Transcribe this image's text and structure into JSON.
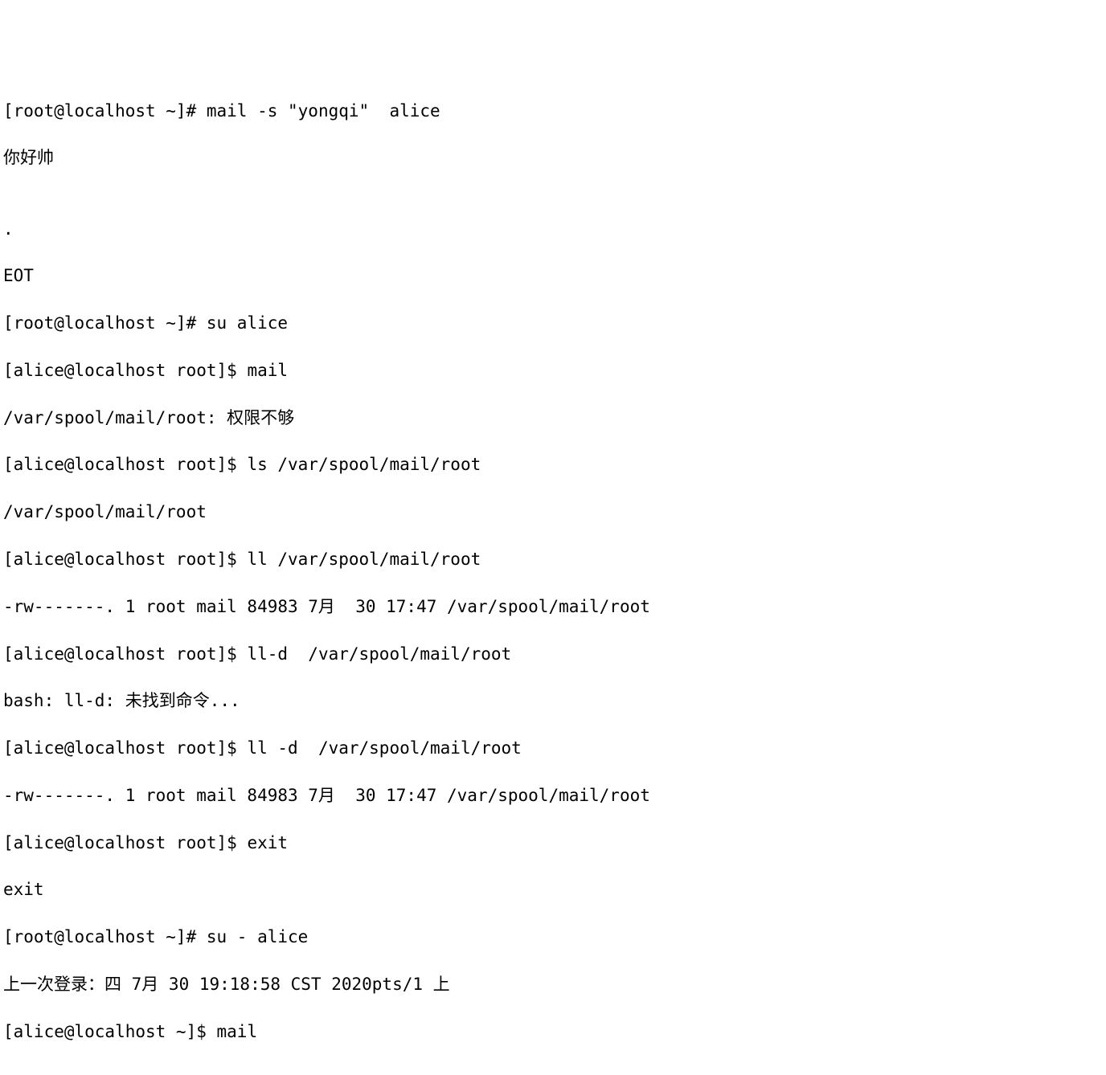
{
  "lines": [
    {
      "type": "cmd",
      "prompt": "[root@localhost ~]# ",
      "command": "mail -s \"yongqi\"  alice"
    },
    {
      "type": "out",
      "text": "你好帅"
    },
    {
      "type": "out",
      "text": ""
    },
    {
      "type": "out",
      "text": "."
    },
    {
      "type": "out",
      "text": "EOT"
    },
    {
      "type": "cmd",
      "prompt": "[root@localhost ~]# ",
      "command": "su alice"
    },
    {
      "type": "cmd",
      "prompt": "[alice@localhost root]$ ",
      "command": "mail"
    },
    {
      "type": "out",
      "text": "/var/spool/mail/root: 权限不够"
    },
    {
      "type": "cmd",
      "prompt": "[alice@localhost root]$ ",
      "command": "ls /var/spool/mail/root"
    },
    {
      "type": "out",
      "text": "/var/spool/mail/root"
    },
    {
      "type": "cmd",
      "prompt": "[alice@localhost root]$ ",
      "command": "ll /var/spool/mail/root"
    },
    {
      "type": "out",
      "text": "-rw-------. 1 root mail 84983 7月  30 17:47 /var/spool/mail/root"
    },
    {
      "type": "cmd",
      "prompt": "[alice@localhost root]$ ",
      "command": "ll-d  /var/spool/mail/root"
    },
    {
      "type": "out",
      "text": "bash: ll-d: 未找到命令..."
    },
    {
      "type": "cmd",
      "prompt": "[alice@localhost root]$ ",
      "command": "ll -d  /var/spool/mail/root"
    },
    {
      "type": "out",
      "text": "-rw-------. 1 root mail 84983 7月  30 17:47 /var/spool/mail/root"
    },
    {
      "type": "cmd",
      "prompt": "[alice@localhost root]$ ",
      "command": "exit"
    },
    {
      "type": "out",
      "text": "exit"
    },
    {
      "type": "cmd",
      "prompt": "[root@localhost ~]# ",
      "command": "su - alice"
    },
    {
      "type": "out",
      "text": "上一次登录：四 7月 30 19:18:58 CST 2020pts/1 上"
    },
    {
      "type": "cmd",
      "prompt": "[alice@localhost ~]$ ",
      "command": "mail"
    }
  ]
}
